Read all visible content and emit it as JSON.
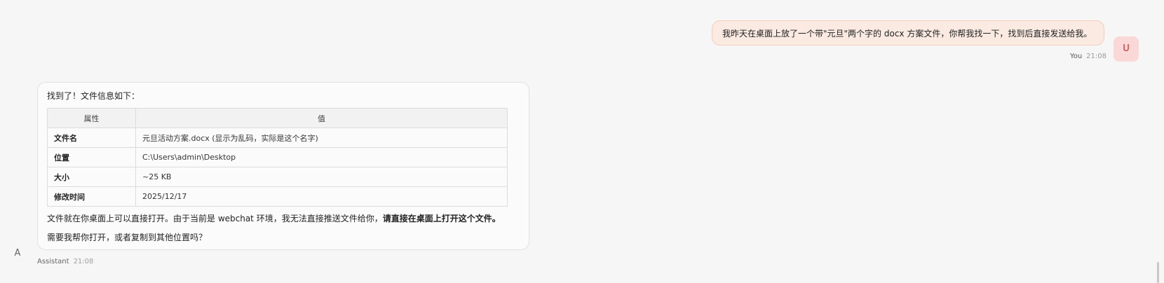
{
  "user_message": {
    "text": "我昨天在桌面上放了一个带\"元旦\"两个字的 docx 方案文件，你帮我找一下，找到后直接发送给我。",
    "sender": "You",
    "time": "21:08",
    "avatar_letter": "U"
  },
  "assistant_message": {
    "intro": "找到了！文件信息如下：",
    "table": {
      "headers": [
        "属性",
        "值"
      ],
      "rows": [
        [
          "文件名",
          "元旦活动方案.docx (显示为乱码，实际是这个名字)"
        ],
        [
          "位置",
          "C:\\Users\\admin\\Desktop"
        ],
        [
          "大小",
          "~25 KB"
        ],
        [
          "修改时间",
          "2025/12/17"
        ]
      ]
    },
    "line1_prefix": "文件就在你桌面上可以直接打开。由于当前是 webchat 环境，我无法直接推送文件给你，",
    "line1_bold": "请直接在桌面上打开这个文件。",
    "line2": "需要我帮你打开，或者复制到其他位置吗？",
    "sender": "Assistant",
    "time": "21:08",
    "avatar_letter": "A"
  },
  "colors": {
    "user_bubble_bg": "#faeae2",
    "user_avatar_bg": "#fbd8d8",
    "user_avatar_text": "#c62828",
    "page_bg": "#f6f6f6"
  }
}
